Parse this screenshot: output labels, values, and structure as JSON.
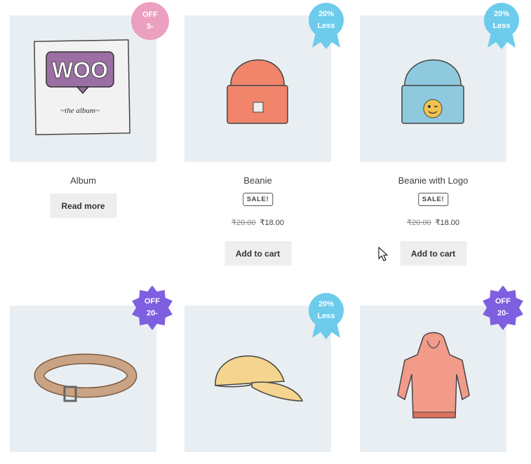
{
  "products": [
    {
      "title": "Album",
      "button": "Read more",
      "badge": {
        "line1": "OFF",
        "line2": "5-",
        "color": "#eba0c0",
        "shape": "circle"
      }
    },
    {
      "title": "Beanie",
      "sale_label": "SALE!",
      "old_price": "₹20.00",
      "new_price": "₹18.00",
      "button": "Add to cart",
      "badge": {
        "line1": "20%",
        "line2": "Less",
        "color": "#6dcbec",
        "shape": "ribbon"
      }
    },
    {
      "title": "Beanie with Logo",
      "sale_label": "SALE!",
      "old_price": "₹20.00",
      "new_price": "₹18.00",
      "button": "Add to cart",
      "badge": {
        "line1": "20%",
        "line2": "Less",
        "color": "#6dcbec",
        "shape": "ribbon"
      }
    },
    {
      "badge": {
        "line1": "OFF",
        "line2": "20-",
        "color": "#7e5fe0",
        "shape": "starburst"
      }
    },
    {
      "badge": {
        "line1": "20%",
        "line2": "Less",
        "color": "#6dcbec",
        "shape": "ribbon"
      }
    },
    {
      "badge": {
        "line1": "OFF",
        "line2": "20-",
        "color": "#7e5fe0",
        "shape": "starburst"
      }
    }
  ],
  "icons": {
    "product_images": [
      "album-icon",
      "beanie-icon",
      "beanie-logo-icon",
      "belt-icon",
      "cap-icon",
      "hoodie-icon"
    ],
    "cursor": "mouse-pointer-icon"
  }
}
